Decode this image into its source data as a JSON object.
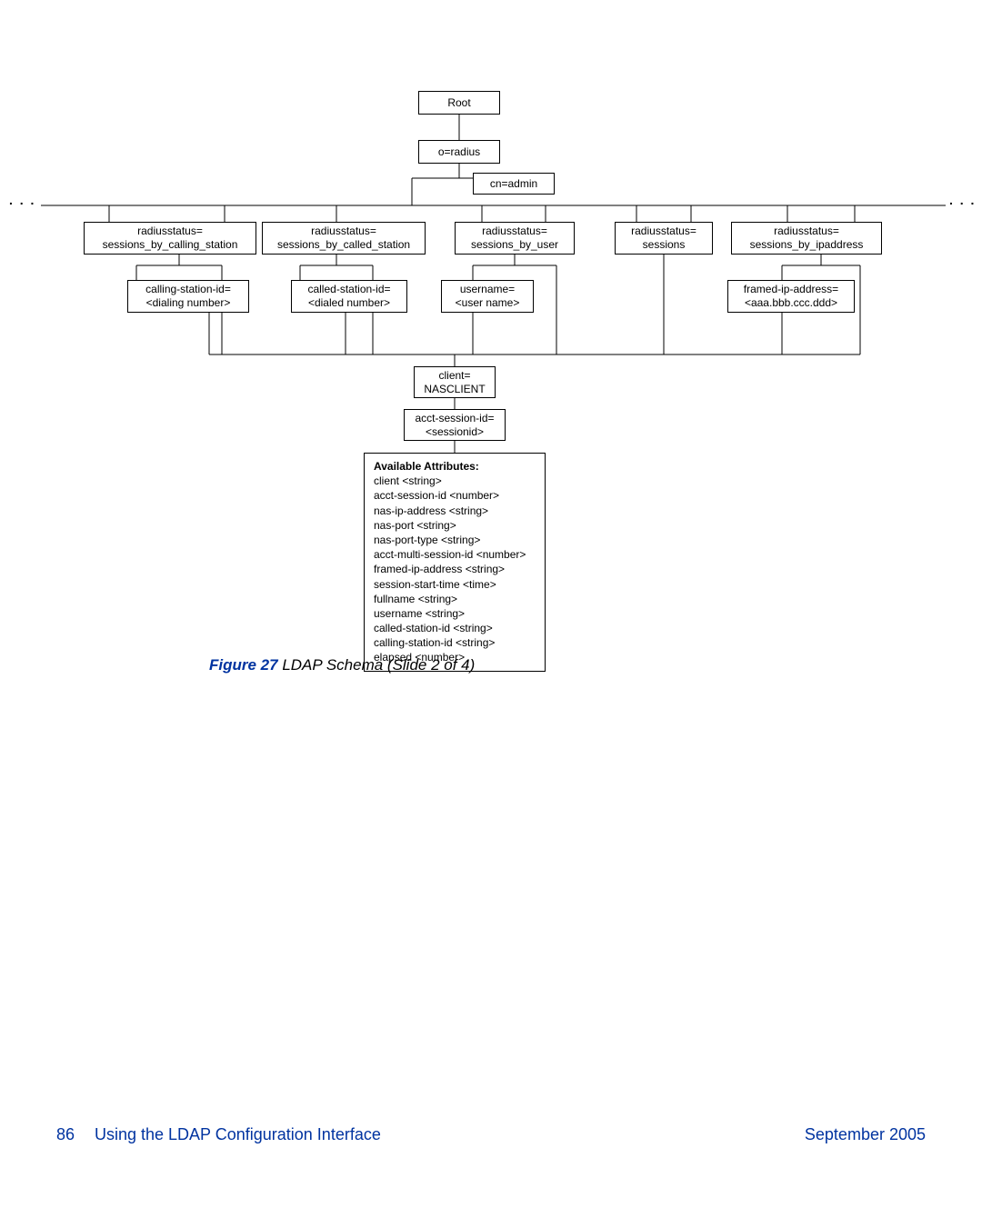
{
  "nodes": {
    "root": "Root",
    "oradius": "o=radius",
    "cnadmin": "cn=admin",
    "row1": {
      "a": {
        "l1": "radiusstatus=",
        "l2": "sessions_by_calling_station"
      },
      "b": {
        "l1": "radiusstatus=",
        "l2": "sessions_by_called_station"
      },
      "c": {
        "l1": "radiusstatus=",
        "l2": "sessions_by_user"
      },
      "d": {
        "l1": "radiusstatus=",
        "l2": "sessions"
      },
      "e": {
        "l1": "radiusstatus=",
        "l2": "sessions_by_ipaddress"
      }
    },
    "row2": {
      "a": {
        "l1": "calling-station-id=",
        "l2": "<dialing number>"
      },
      "b": {
        "l1": "called-station-id=",
        "l2": "<dialed number>"
      },
      "c": {
        "l1": "username=",
        "l2": "<user name>"
      },
      "e": {
        "l1": "framed-ip-address=",
        "l2": "<aaa.bbb.ccc.ddd>"
      }
    },
    "client": {
      "l1": "client=",
      "l2": "NASCLIENT"
    },
    "sessid": {
      "l1": "acct-session-id=",
      "l2": "<sessionid>"
    }
  },
  "attrs": {
    "title": "Available Attributes:",
    "items": [
      "client <string>",
      "acct-session-id <number>",
      "nas-ip-address <string>",
      "nas-port <string>",
      "nas-port-type <string>",
      "acct-multi-session-id <number>",
      "framed-ip-address <string>",
      "session-start-time <time>",
      "fullname <string>",
      "username <string>",
      "called-station-id <string>",
      "calling-station-id <string>",
      "elapsed <number>"
    ]
  },
  "caption": {
    "fig": "Figure 27",
    "text": " LDAP Schema (Slide 2 of 4)"
  },
  "footer": {
    "page": "86",
    "chapter": "Using the LDAP Configuration Interface",
    "date": "September 2005"
  },
  "ellipsis": ". . ."
}
